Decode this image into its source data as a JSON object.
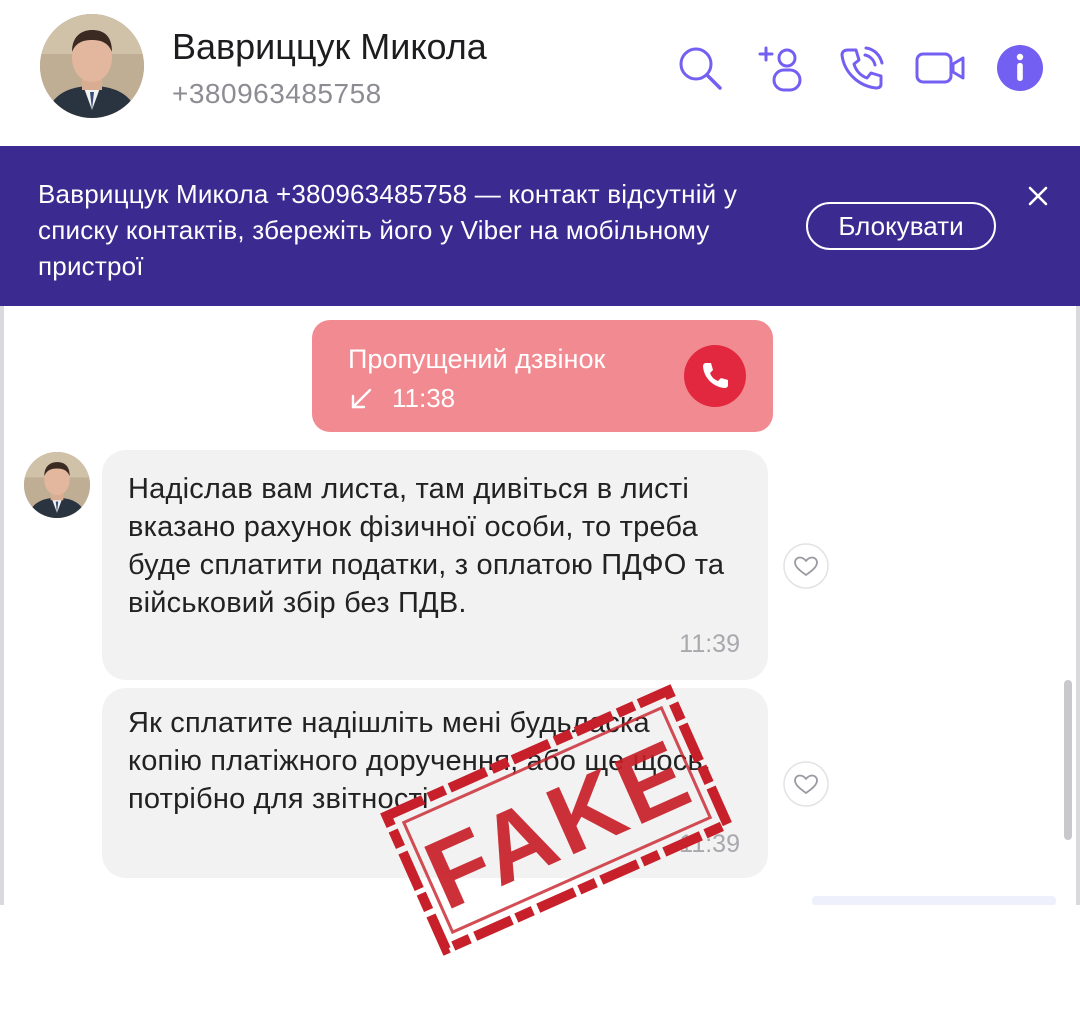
{
  "header": {
    "contact_name": "Вавриццук Микола",
    "contact_phone": "+380963485758",
    "icons": [
      "search-icon",
      "add-participant-icon",
      "voice-call-icon",
      "video-call-icon",
      "info-icon"
    ]
  },
  "banner": {
    "text": "Вавриццук Микола +380963485758 — контакт відсутній у списку контактів, збережіть його у Viber на мобільному пристрої",
    "block_label": "Блокувати"
  },
  "missed_call": {
    "label": "Пропущений дзвінок",
    "time": "11:38"
  },
  "messages": [
    {
      "text": "Надіслав вам листа, там дивіться в листі вказано рахунок фізичної особи, то треба буде сплатити податки, з оплатою ПДФО та військовий збір без ПДВ.",
      "time": "11:39"
    },
    {
      "text": "Як сплатите надішліть мені будьласка копію платіжного доручення, або ще щось, потрібно для звітності",
      "time": "11:39"
    }
  ],
  "stamp": {
    "text": "FAKE"
  },
  "colors": {
    "accent": "#7360f2",
    "banner_bg": "#3b2a8f",
    "missed_bg": "#f28a91",
    "call_red": "#e2283e",
    "stamp_red": "#c8202a",
    "bubble_bg": "#f2f2f3"
  }
}
